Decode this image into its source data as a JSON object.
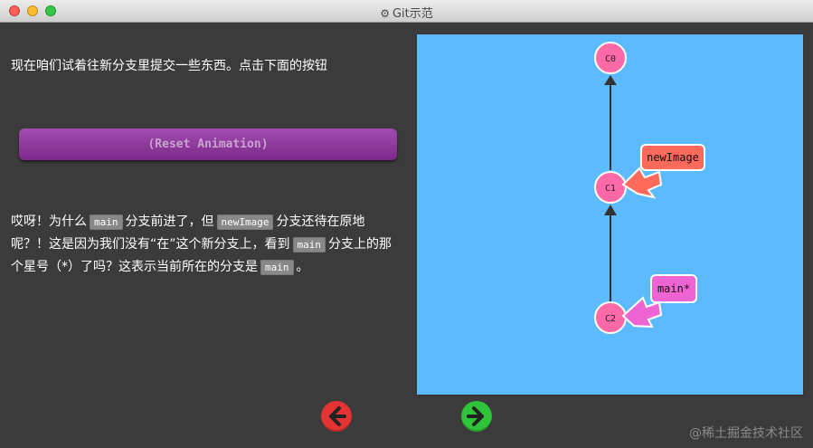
{
  "window": {
    "title": "Git示范"
  },
  "instructions": {
    "intro": "现在咱们试着往新分支里提交一些东西。点击下面的按钮",
    "reset_label": "(Reset Animation)",
    "explain_segments": [
      "哎呀！为什么",
      "main",
      "分支前进了，但",
      "newImage",
      "分支还待在原地呢？！这是因为我们没有“在”这个新分支上，看到",
      "main",
      "分支上的那个星号（*）了吗？这表示当前所在的分支是",
      "main",
      "。"
    ]
  },
  "graph": {
    "commits": [
      {
        "id": "C0",
        "order": 0
      },
      {
        "id": "C1",
        "order": 1
      },
      {
        "id": "C2",
        "order": 2
      }
    ],
    "branches": [
      {
        "label": "newImage",
        "target": "C1",
        "color": "#ff6a5b"
      },
      {
        "label": "main*",
        "target": "C2",
        "color": "#ef64d3"
      }
    ],
    "colors": {
      "background": "#5cbaff",
      "commit": "#ff6aa6",
      "edge": "#333333"
    }
  },
  "nav": {
    "prev_icon": "arrow-left-icon",
    "next_icon": "arrow-right-icon"
  },
  "watermark": "@稀土掘金技术社区"
}
